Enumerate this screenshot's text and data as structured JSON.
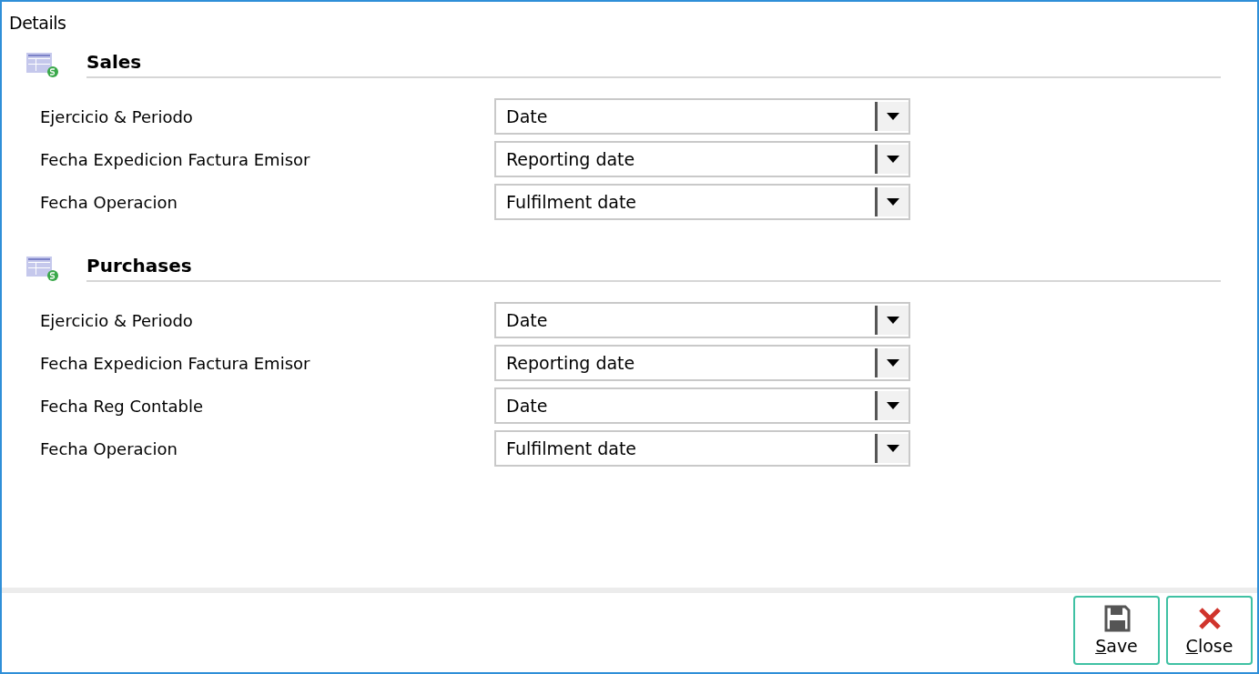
{
  "window": {
    "title": "Details"
  },
  "sections": [
    {
      "title": "Sales",
      "fields": [
        {
          "label": "Ejercicio & Periodo",
          "value": "Date"
        },
        {
          "label": "Fecha Expedicion Factura Emisor",
          "value": "Reporting date"
        },
        {
          "label": "Fecha Operacion",
          "value": "Fulfilment date"
        }
      ]
    },
    {
      "title": "Purchases",
      "fields": [
        {
          "label": "Ejercicio & Periodo",
          "value": "Date"
        },
        {
          "label": "Fecha Expedicion Factura Emisor",
          "value": "Reporting date"
        },
        {
          "label": "Fecha Reg Contable",
          "value": "Date"
        },
        {
          "label": "Fecha Operacion",
          "value": "Fulfilment date"
        }
      ]
    }
  ],
  "buttons": [
    {
      "kind": "save",
      "label": "Save"
    },
    {
      "kind": "close",
      "label": "Close"
    }
  ]
}
